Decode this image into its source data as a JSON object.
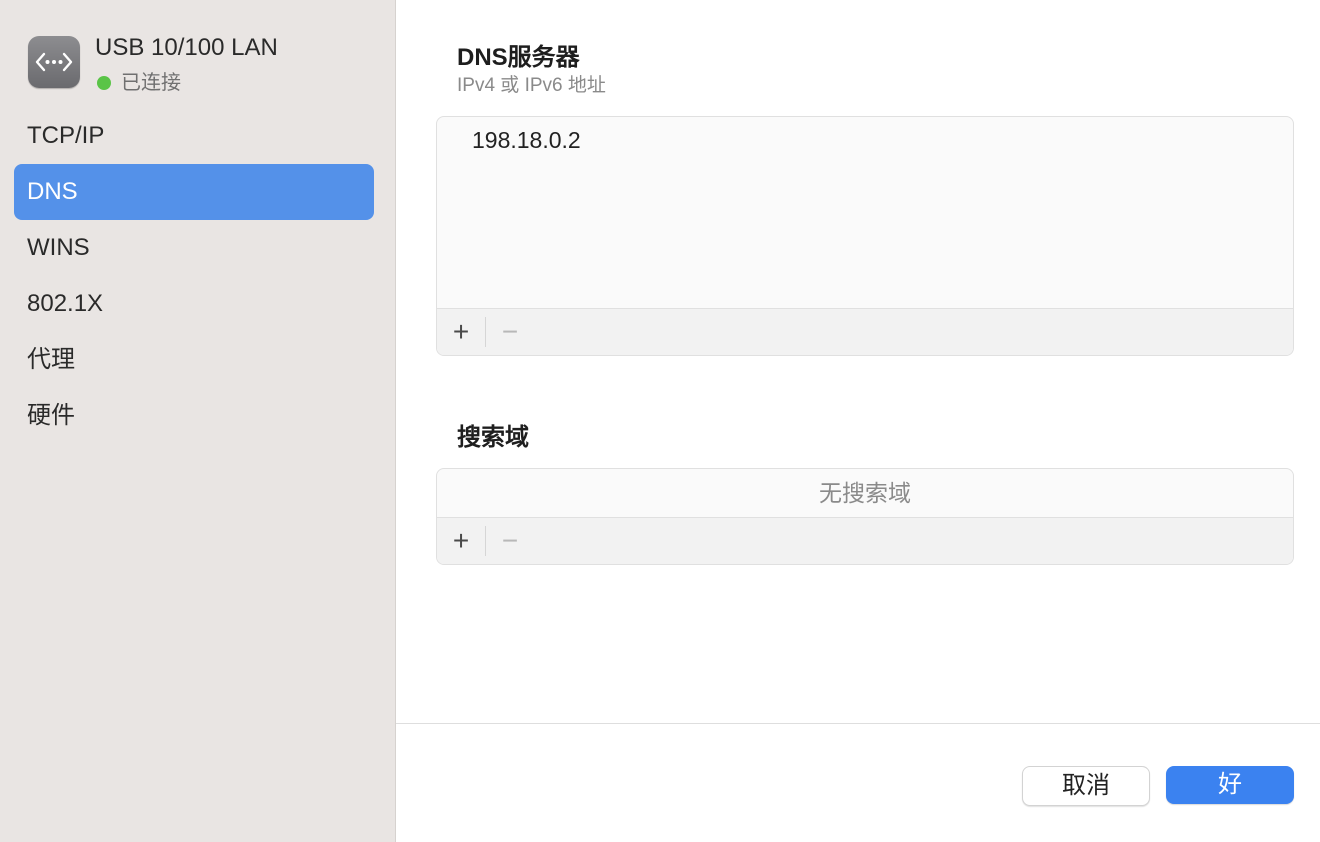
{
  "connection": {
    "title": "USB 10/100 LAN",
    "status": "已连接",
    "icon": "ethernet-icon",
    "status_color": "#5ac447"
  },
  "sidebar": {
    "items": [
      {
        "label": "TCP/IP",
        "selected": false
      },
      {
        "label": "DNS",
        "selected": true
      },
      {
        "label": "WINS",
        "selected": false
      },
      {
        "label": "802.1X",
        "selected": false
      },
      {
        "label": "代理",
        "selected": false
      },
      {
        "label": "硬件",
        "selected": false
      }
    ]
  },
  "dns_servers": {
    "title": "DNS服务器",
    "subtitle": "IPv4 或 IPv6 地址",
    "entries": [
      "198.18.0.2"
    ],
    "add": "+",
    "remove": "−"
  },
  "search_domains": {
    "title": "搜索域",
    "empty_text": "无搜索域",
    "add": "+",
    "remove": "−"
  },
  "footer": {
    "cancel": "取消",
    "ok": "好"
  },
  "colors": {
    "accent": "#3b82f0",
    "sidebar_selected": "#5491e9",
    "sidebar_bg": "#e9e5e3"
  }
}
